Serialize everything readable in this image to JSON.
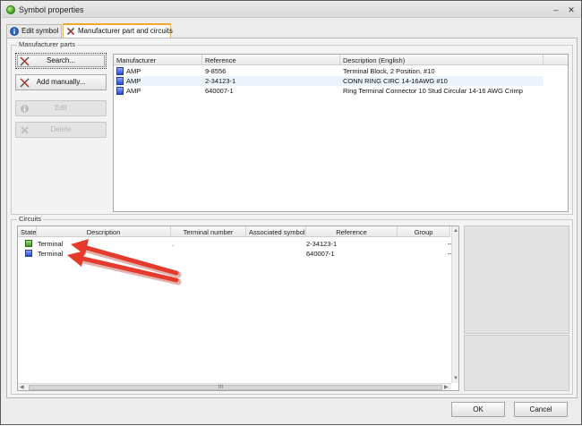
{
  "window": {
    "title": "Symbol properties",
    "minimize_glyph": "–",
    "close_glyph": "✕"
  },
  "tabs": [
    {
      "label": "Edit symbol",
      "icon": "info-icon",
      "active": false
    },
    {
      "label": "Manufacturer part and circuits",
      "icon": "tools-icon",
      "active": true
    }
  ],
  "manufacturer_parts": {
    "group_label": "Manufacturer parts",
    "buttons": {
      "search": "Search...",
      "add_manually": "Add manually...",
      "edit": "Edit",
      "delete": "Delete"
    },
    "columns": [
      "Manufacturer",
      "Reference",
      "Description (English)"
    ],
    "rows": [
      {
        "manufacturer": "AMP",
        "reference": "9-8556",
        "description": "Terminal Block, 2 Position, #10"
      },
      {
        "manufacturer": "AMP",
        "reference": "2-34123-1",
        "description": "CONN RING CIRC 14-16AWG #10"
      },
      {
        "manufacturer": "AMP",
        "reference": "640007-1",
        "description": "Ring Terminal Connector 10 Stud Circular 14-16 AWG Crimp"
      }
    ]
  },
  "circuits": {
    "group_label": "Circuits",
    "columns": [
      "State",
      "Description",
      "Terminal number",
      "Associated symbol",
      "Reference",
      "Group"
    ],
    "rows": [
      {
        "description": "Terminal",
        "terminal_number": ".",
        "associated_symbol": "",
        "reference": "2-34123-1",
        "group": "--"
      },
      {
        "description": "Terminal",
        "terminal_number": "",
        "associated_symbol": "",
        "reference": "640007-1",
        "group": "--"
      }
    ],
    "scroll": {
      "left": "◀",
      "center": "III",
      "right": "▶",
      "up": "▲",
      "down": "▼"
    }
  },
  "footer": {
    "ok": "OK",
    "cancel": "Cancel"
  },
  "colors": {
    "accent": "#f0a830",
    "annotation_arrow": "#e53b2c",
    "state_ok": "#3c9a1f",
    "part_icon": "#2648d6"
  }
}
